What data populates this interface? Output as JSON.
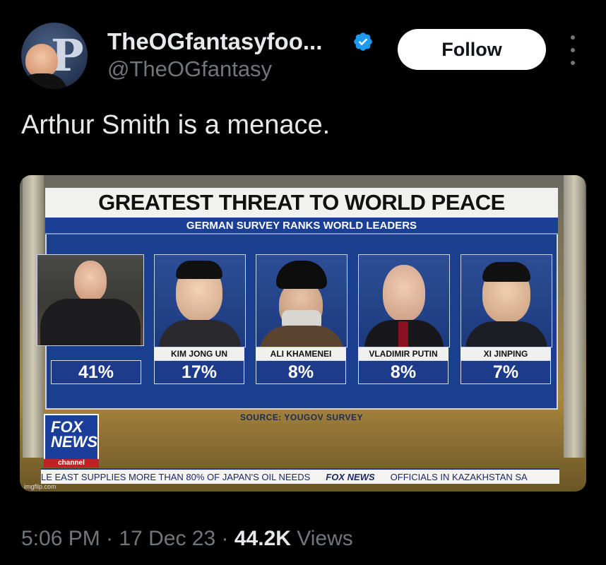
{
  "author": {
    "display_name": "TheOGfantasyfoo...",
    "handle": "@TheOGfantasy",
    "avatar_letter": "P"
  },
  "follow_label": "Follow",
  "tweet_text": "Arthur Smith is a menace.",
  "media": {
    "title": "GREATEST THREAT TO WORLD PEACE",
    "subtitle": "GERMAN SURVEY RANKS WORLD LEADERS",
    "cards": [
      {
        "name": "",
        "pct": "41%"
      },
      {
        "name": "KIM JONG UN",
        "pct": "17%"
      },
      {
        "name": "ALI KHAMENEI",
        "pct": "8%"
      },
      {
        "name": "VLADIMIR PUTIN",
        "pct": "8%"
      },
      {
        "name": "XI JINPING",
        "pct": "7%"
      }
    ],
    "source": "SOURCE: YOUGOV SURVEY",
    "logo_line1": "FOX",
    "logo_line2": "NEWS",
    "logo_channel": "channel",
    "ticker_left": "LE EAST SUPPLIES MORE THAN 80% OF JAPAN'S OIL NEEDS",
    "ticker_brand": "FOX NEWS",
    "ticker_right": "OFFICIALS IN KAZAKHSTAN SA",
    "watermark": "imgflip.com"
  },
  "meta": {
    "time": "5:06 PM",
    "sep": "·",
    "date": "17 Dec 23",
    "views_count": "44.2K",
    "views_label": "Views"
  },
  "colors": {
    "background": "#000000",
    "verified": "#1d9bf0",
    "secondary_text": "#71767b",
    "board_blue": "#1a3f8f"
  }
}
